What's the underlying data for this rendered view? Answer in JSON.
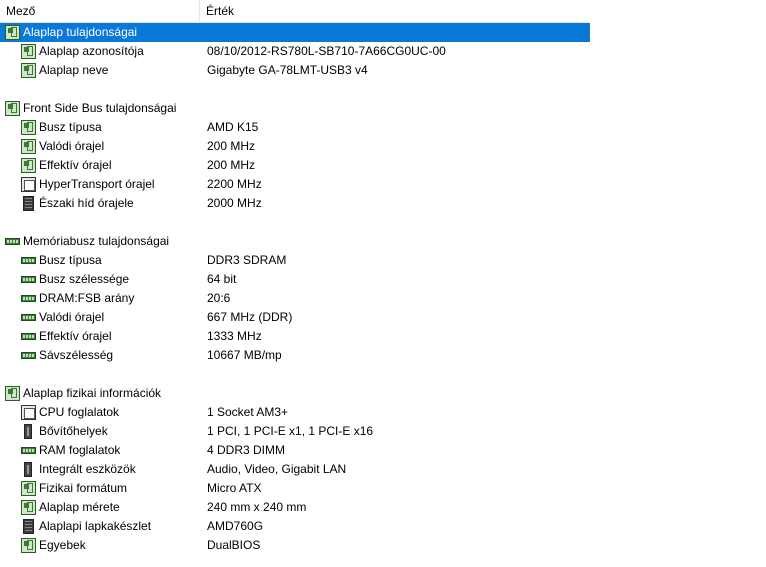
{
  "columns": {
    "field": "Mező",
    "value": "Érték"
  },
  "rows": [
    {
      "kind": "group",
      "icon": "motherboard-icon",
      "name": "Alaplap tulajdonságai",
      "value": "",
      "selected": true
    },
    {
      "kind": "item",
      "icon": "motherboard-icon",
      "name": "Alaplap azonosítója",
      "value": "08/10/2012-RS780L-SB710-7A66CG0UC-00"
    },
    {
      "kind": "item",
      "icon": "motherboard-icon",
      "name": "Alaplap neve",
      "value": "Gigabyte GA-78LMT-USB3 v4"
    },
    {
      "kind": "spacer"
    },
    {
      "kind": "group",
      "icon": "motherboard-icon",
      "name": "Front Side Bus tulajdonságai",
      "value": ""
    },
    {
      "kind": "item",
      "icon": "motherboard-icon",
      "name": "Busz típusa",
      "value": "AMD K15"
    },
    {
      "kind": "item",
      "icon": "motherboard-icon",
      "name": "Valódi órajel",
      "value": "200 MHz"
    },
    {
      "kind": "item",
      "icon": "motherboard-icon",
      "name": "Effektív órajel",
      "value": "200 MHz"
    },
    {
      "kind": "item",
      "icon": "cpu-socket-icon",
      "name": "HyperTransport órajel",
      "value": "2200 MHz"
    },
    {
      "kind": "item",
      "icon": "chip-icon",
      "name": "Északi híd órajele",
      "value": "2000 MHz"
    },
    {
      "kind": "spacer"
    },
    {
      "kind": "group",
      "icon": "memory-icon",
      "name": "Memóriabusz tulajdonságai",
      "value": ""
    },
    {
      "kind": "item",
      "icon": "memory-icon",
      "name": "Busz típusa",
      "value": "DDR3 SDRAM"
    },
    {
      "kind": "item",
      "icon": "memory-icon",
      "name": "Busz szélessége",
      "value": "64 bit"
    },
    {
      "kind": "item",
      "icon": "memory-icon",
      "name": "DRAM:FSB arány",
      "value": "20:6"
    },
    {
      "kind": "item",
      "icon": "memory-icon",
      "name": "Valódi órajel",
      "value": "667 MHz (DDR)"
    },
    {
      "kind": "item",
      "icon": "memory-icon",
      "name": "Effektív órajel",
      "value": "1333 MHz"
    },
    {
      "kind": "item",
      "icon": "memory-icon",
      "name": "Sávszélesség",
      "value": "10667 MB/mp"
    },
    {
      "kind": "spacer"
    },
    {
      "kind": "group",
      "icon": "motherboard-icon",
      "name": "Alaplap fizikai információk",
      "value": ""
    },
    {
      "kind": "item",
      "icon": "cpu-socket-icon",
      "name": "CPU foglalatok",
      "value": "1 Socket AM3+"
    },
    {
      "kind": "item",
      "icon": "expansion-slot-icon",
      "name": "Bővítőhelyek",
      "value": "1 PCI, 1 PCI-E x1, 1 PCI-E x16"
    },
    {
      "kind": "item",
      "icon": "memory-icon",
      "name": "RAM foglalatok",
      "value": "4 DDR3 DIMM"
    },
    {
      "kind": "item",
      "icon": "expansion-slot-icon",
      "name": "Integrált eszközök",
      "value": "Audio, Video, Gigabit LAN"
    },
    {
      "kind": "item",
      "icon": "motherboard-icon",
      "name": "Fizikai formátum",
      "value": "Micro ATX"
    },
    {
      "kind": "item",
      "icon": "motherboard-icon",
      "name": "Alaplap mérete",
      "value": "240 mm x 240 mm"
    },
    {
      "kind": "item",
      "icon": "chip-icon",
      "name": "Alaplapi lapkakészlet",
      "value": "AMD760G"
    },
    {
      "kind": "item",
      "icon": "motherboard-icon",
      "name": "Egyebek",
      "value": "DualBIOS"
    }
  ]
}
